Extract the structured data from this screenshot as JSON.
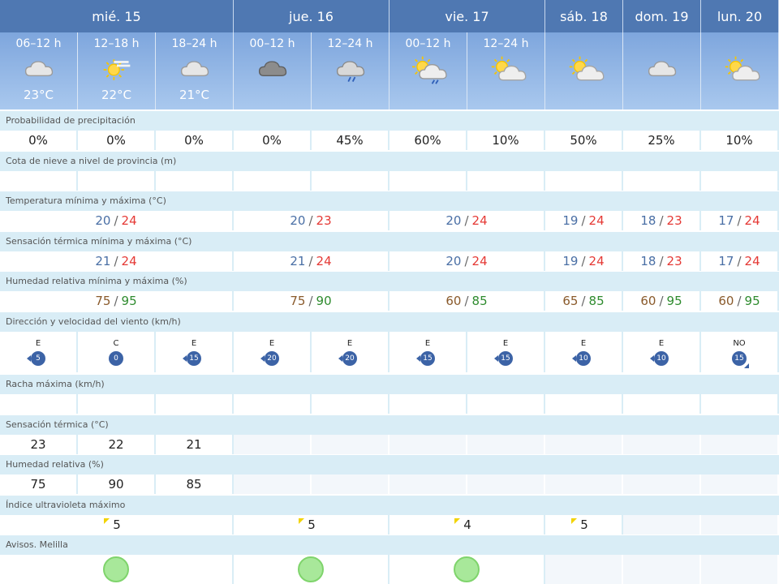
{
  "days": [
    {
      "label": "mié. 15",
      "span": 3
    },
    {
      "label": "jue. 16",
      "span": 2
    },
    {
      "label": "vie. 17",
      "span": 2
    },
    {
      "label": "sáb. 18",
      "span": 1
    },
    {
      "label": "dom. 19",
      "span": 1
    },
    {
      "label": "lun. 20",
      "span": 1
    }
  ],
  "periods": [
    {
      "label": "06–12 h",
      "icon": "cloudy",
      "temp": "23°C"
    },
    {
      "label": "12–18 h",
      "icon": "sun-haze",
      "temp": "22°C"
    },
    {
      "label": "18–24 h",
      "icon": "cloudy",
      "temp": "21°C"
    },
    {
      "label": "00–12 h",
      "icon": "overcast",
      "temp": ""
    },
    {
      "label": "12–24 h",
      "icon": "cloud-rain",
      "temp": ""
    },
    {
      "label": "00–12 h",
      "icon": "sun-cloud-rain",
      "temp": ""
    },
    {
      "label": "12–24 h",
      "icon": "sun-cloud",
      "temp": ""
    },
    {
      "label": "",
      "icon": "sun-cloud",
      "temp": ""
    },
    {
      "label": "",
      "icon": "cloudy",
      "temp": ""
    },
    {
      "label": "",
      "icon": "sun-cloud",
      "temp": ""
    }
  ],
  "sections": {
    "precip": "Probabilidad de precipitación",
    "snow": "Cota de nieve a nivel de provincia (m)",
    "temp": "Temperatura mínima y máxima (°C)",
    "feels": "Sensación térmica mínima y máxima (°C)",
    "humidity": "Humedad relativa mínima y máxima (%)",
    "wind": "Dirección y velocidad del viento (km/h)",
    "gust": "Racha máxima (km/h)",
    "feels_single": "Sensación térmica (°C)",
    "humidity_single": "Humedad relativa (%)",
    "uv": "Índice ultravioleta máximo",
    "avisos": "Avisos. Melilla"
  },
  "precip": [
    "0%",
    "0%",
    "0%",
    "0%",
    "45%",
    "60%",
    "10%",
    "50%",
    "25%",
    "10%"
  ],
  "temp_minmax": [
    {
      "min": "20",
      "max": "24"
    },
    {
      "min": "20",
      "max": "23"
    },
    {
      "min": "20",
      "max": "24"
    },
    {
      "min": "19",
      "max": "24"
    },
    {
      "min": "18",
      "max": "23"
    },
    {
      "min": "17",
      "max": "24"
    }
  ],
  "feels_minmax": [
    {
      "min": "21",
      "max": "24"
    },
    {
      "min": "21",
      "max": "24"
    },
    {
      "min": "20",
      "max": "24"
    },
    {
      "min": "19",
      "max": "24"
    },
    {
      "min": "18",
      "max": "23"
    },
    {
      "min": "17",
      "max": "24"
    }
  ],
  "humidity_minmax": [
    {
      "min": "75",
      "max": "95"
    },
    {
      "min": "75",
      "max": "90"
    },
    {
      "min": "60",
      "max": "85"
    },
    {
      "min": "65",
      "max": "85"
    },
    {
      "min": "60",
      "max": "95"
    },
    {
      "min": "60",
      "max": "95"
    }
  ],
  "wind": [
    {
      "dir": "E",
      "speed": "5"
    },
    {
      "dir": "C",
      "speed": "0"
    },
    {
      "dir": "E",
      "speed": "15"
    },
    {
      "dir": "E",
      "speed": "20"
    },
    {
      "dir": "E",
      "speed": "20"
    },
    {
      "dir": "E",
      "speed": "15"
    },
    {
      "dir": "E",
      "speed": "15"
    },
    {
      "dir": "E",
      "speed": "10"
    },
    {
      "dir": "E",
      "speed": "10"
    },
    {
      "dir": "NO",
      "speed": "15"
    }
  ],
  "feels_single": [
    "23",
    "22",
    "21"
  ],
  "humidity_single": [
    "75",
    "90",
    "85"
  ],
  "uv": [
    "5",
    "5",
    "4",
    "5"
  ],
  "avisos_count": 3,
  "colors": {
    "header": "#4f78b2",
    "section": "#d9edf6",
    "temp_min": "#4a6fa5",
    "temp_max": "#e53935",
    "hum_min": "#8a5a2b",
    "hum_max": "#2e8b2e",
    "wind_badge": "#3c63a6",
    "uv_flag": "#f2d300",
    "aviso_green": "#a8e89a"
  }
}
